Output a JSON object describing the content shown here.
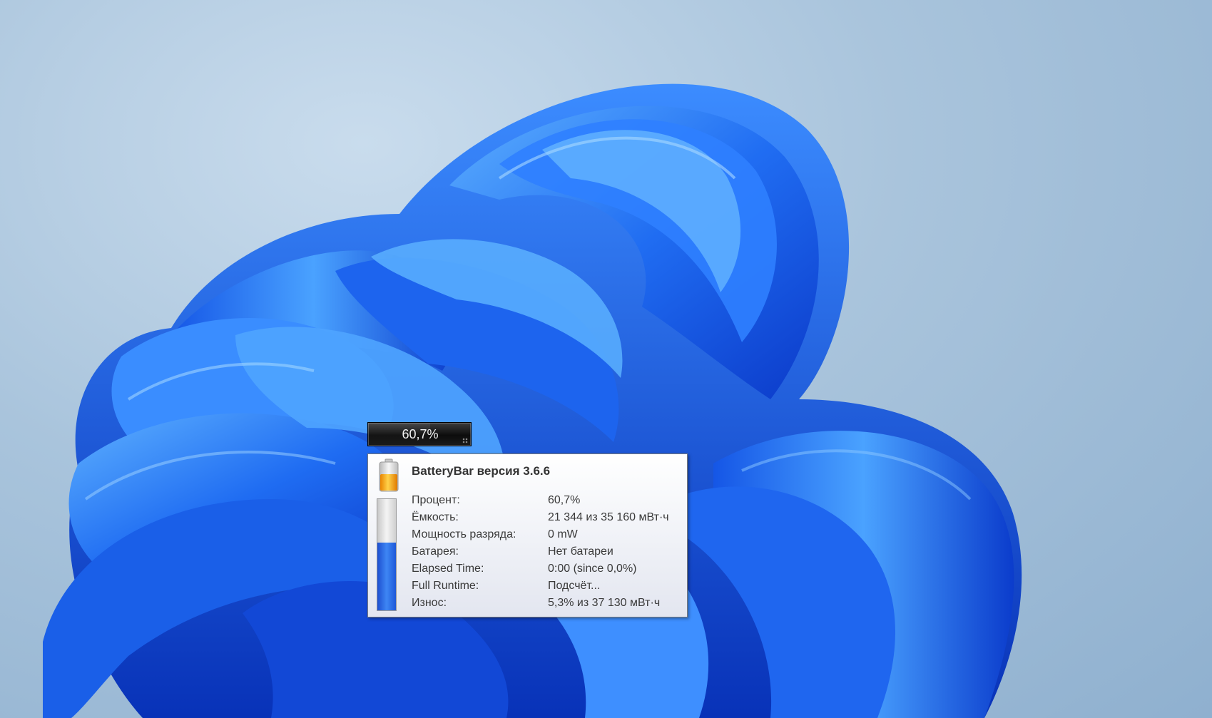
{
  "gadget": {
    "percent_text": "60,7%",
    "charge_level": 0.607
  },
  "tooltip": {
    "title": "BatteryBar версия 3.6.6",
    "rows": [
      {
        "label": "Процент:",
        "value": "60,7%"
      },
      {
        "label": "Ёмкость:",
        "value": "21 344 из 35 160 мВт·ч"
      },
      {
        "label": "Мощность разряда:",
        "value": "0 mW"
      },
      {
        "label": "Батарея:",
        "value": "Нет батареи"
      },
      {
        "label": "Elapsed Time:",
        "value": "0:00 (since 0,0%)"
      },
      {
        "label": "Full Runtime:",
        "value": "Подсчёт..."
      },
      {
        "label": "Износ:",
        "value": "5,3% из 37 130 мВт·ч"
      }
    ]
  },
  "colors": {
    "battery_fill": "#2f6fe8",
    "battery_icon": "#f39a12"
  },
  "icons": {
    "battery": "battery-icon",
    "level": "battery-level-gauge"
  }
}
